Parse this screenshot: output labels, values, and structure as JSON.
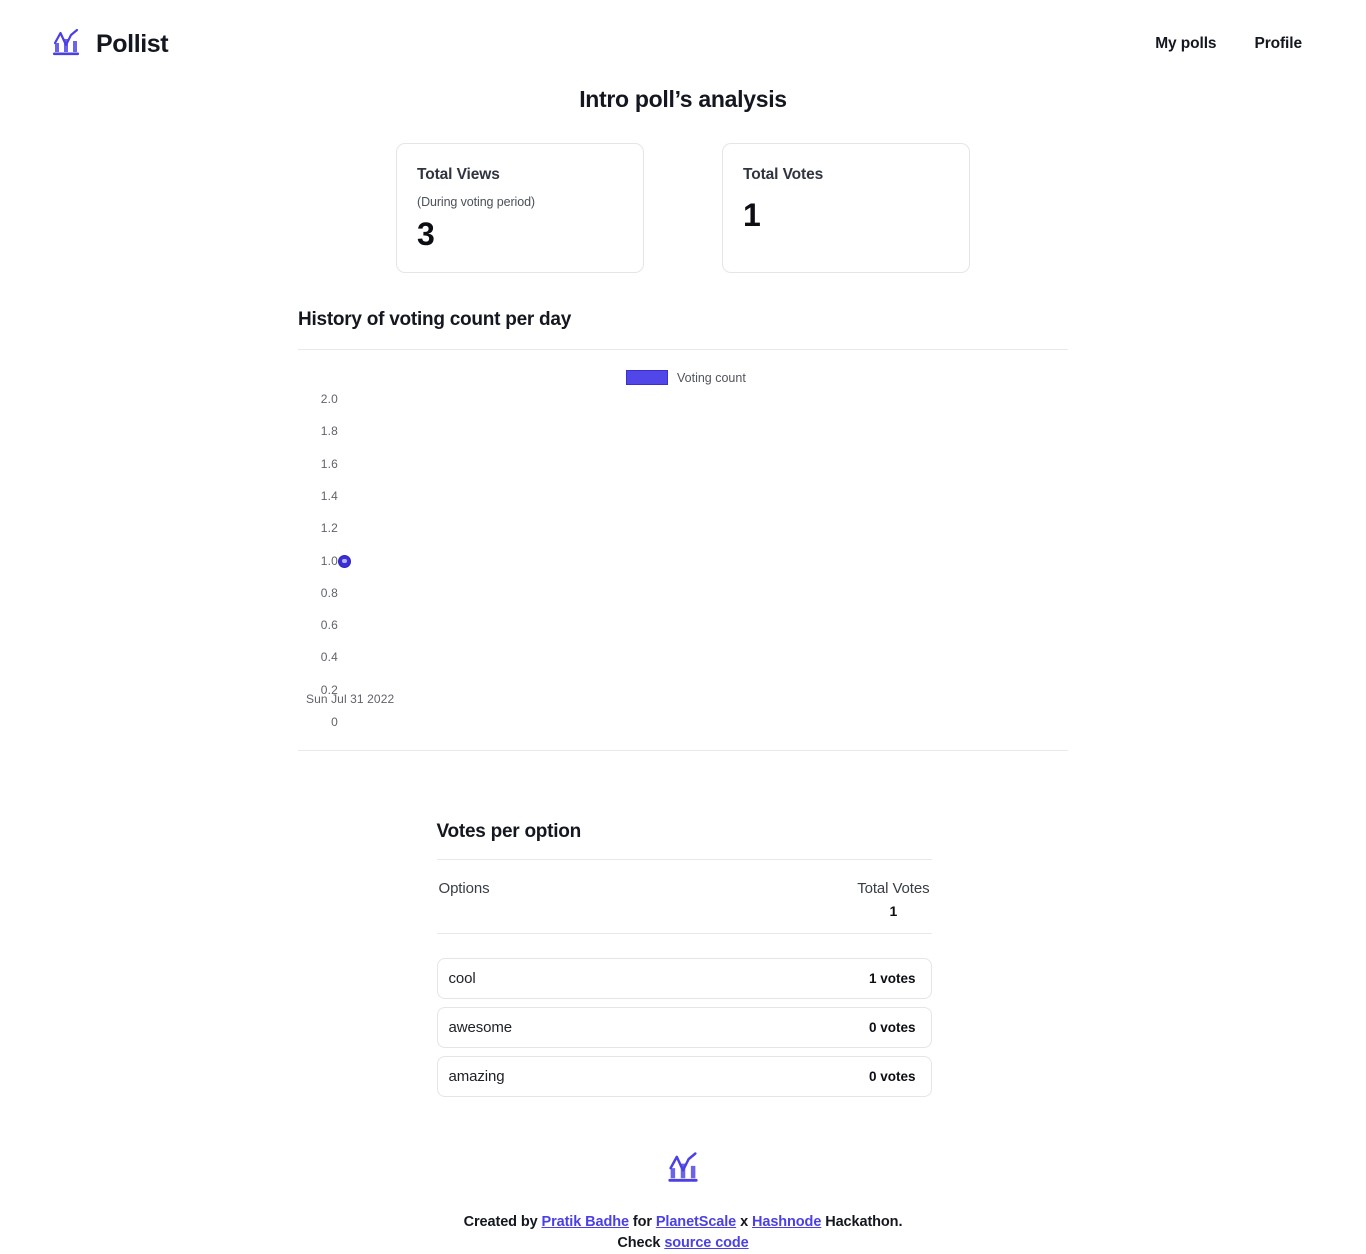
{
  "header": {
    "logo_icon": "bar-chart-logo-icon",
    "brand": "Pollist",
    "nav": [
      {
        "label": "My polls"
      },
      {
        "label": "Profile"
      }
    ]
  },
  "page": {
    "title": "Intro poll’s analysis"
  },
  "stats": {
    "views": {
      "label": "Total Views",
      "sublabel": "(During voting period)",
      "value": "3"
    },
    "votes": {
      "label": "Total Votes",
      "value": "1"
    }
  },
  "history": {
    "heading": "History of voting count per day",
    "legend_label": "Voting count",
    "accent_color": "#5146e8"
  },
  "options_section": {
    "heading": "Votes per option",
    "col_options": "Options",
    "col_total_votes": "Total Votes",
    "total_votes_value": "1",
    "rows": [
      {
        "name": "cool",
        "votes": "1 votes"
      },
      {
        "name": "awesome",
        "votes": "0 votes"
      },
      {
        "name": "amazing",
        "votes": "0 votes"
      }
    ]
  },
  "footer": {
    "logo_icon": "bar-chart-logo-icon",
    "line1_prefix": "Created by ",
    "author": "Pratik Badhe",
    "line1_mid1": " for ",
    "sponsor1": "PlanetScale",
    "line1_x": " x ",
    "sponsor2": "Hashnode",
    "line1_suffix": " Hackathon.",
    "line2_prefix": "Check ",
    "source_link": "source code"
  },
  "chart_data": {
    "type": "scatter",
    "title": "History of voting count per day",
    "xlabel": "",
    "ylabel": "",
    "categories": [
      "Sun Jul 31 2022"
    ],
    "x": [
      "Sun Jul 31 2022"
    ],
    "series": [
      {
        "name": "Voting count",
        "values": [
          1
        ],
        "color": "#5146e8"
      }
    ],
    "ytick_labels": [
      "2.0",
      "1.8",
      "1.6",
      "1.4",
      "1.2",
      "1.0",
      "0.8",
      "0.6",
      "0.4",
      "0.2",
      "0"
    ],
    "ytick_values": [
      2.0,
      1.8,
      1.6,
      1.4,
      1.2,
      1.0,
      0.8,
      0.6,
      0.4,
      0.2,
      0
    ],
    "ylim": [
      0,
      2
    ],
    "xtick_labels": [
      "Sun Jul 31 2022"
    ],
    "grid": false,
    "legend": {
      "position": "top-center",
      "entries": [
        "Voting count"
      ]
    }
  }
}
